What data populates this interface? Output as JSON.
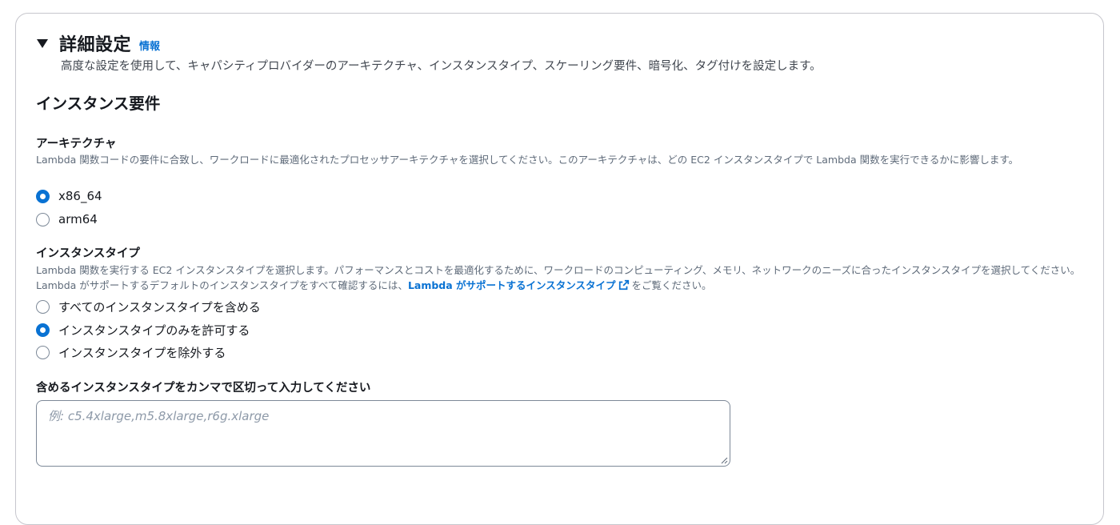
{
  "section": {
    "title": "詳細設定",
    "info_link": "情報",
    "description": "高度な設定を使用して、キャパシティプロバイダーのアーキテクチャ、インスタンスタイプ、スケーリング要件、暗号化、タグ付けを設定します。"
  },
  "instance_requirements": {
    "heading": "インスタンス要件"
  },
  "architecture": {
    "label": "アーキテクチャ",
    "description": "Lambda 関数コードの要件に合致し、ワークロードに最適化されたプロセッサアーキテクチャを選択してください。このアーキテクチャは、どの EC2 インスタンスタイプで Lambda 関数を実行できるかに影響します。",
    "options": [
      {
        "label": "x86_64",
        "checked": true
      },
      {
        "label": "arm64",
        "checked": false
      }
    ]
  },
  "instance_type": {
    "label": "インスタンスタイプ",
    "description_before": "Lambda 関数を実行する EC2 インスタンスタイプを選択します。パフォーマンスとコストを最適化するために、ワークロードのコンピューティング、メモリ、ネットワークのニーズに合ったインスタンスタイプを選択してください。Lambda がサポートするデフォルトのインスタンスタイプをすべて確認するには、",
    "description_link": "Lambda がサポートするインスタンスタイプ",
    "description_after": "をご覧ください。",
    "options": [
      {
        "label": "すべてのインスタンスタイプを含める",
        "checked": false
      },
      {
        "label": "インスタンスタイプのみを許可する",
        "checked": true
      },
      {
        "label": "インスタンスタイプを除外する",
        "checked": false
      }
    ]
  },
  "include_types": {
    "label": "含めるインスタンスタイプをカンマで区切って入力してください",
    "value": "",
    "placeholder": "例: c5.4xlarge,m5.8xlarge,r6g.xlarge"
  },
  "colors": {
    "accent": "#0972d3",
    "border": "#7d8998",
    "text": "#16191f",
    "muted": "#5f6b7a"
  },
  "icons": {
    "expand": "caret-down-icon",
    "external_link": "external-link-icon"
  }
}
